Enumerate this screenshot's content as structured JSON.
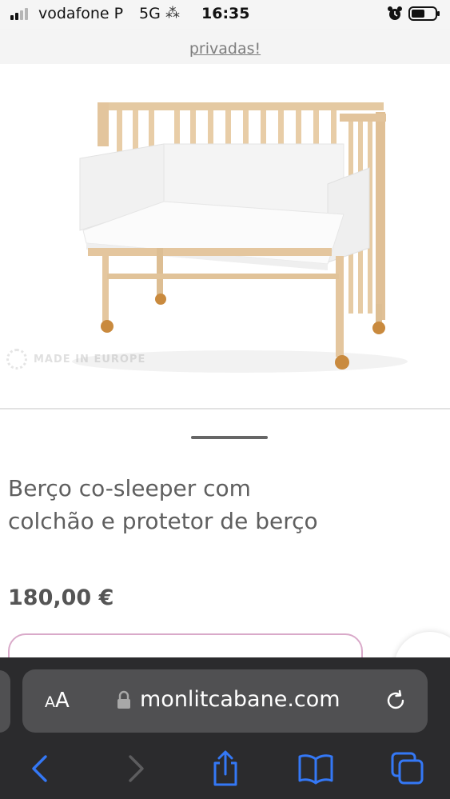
{
  "status_bar": {
    "carrier": "vodafone P",
    "network": "5G",
    "time": "16:35"
  },
  "top_strip": {
    "link_text": "privadas!"
  },
  "product": {
    "image_badge": "MADE IN EUROPE",
    "title": "Berço co-sleeper com colchão e protetor de berço",
    "price": "180,00 €"
  },
  "browser": {
    "text_size_label": "AA",
    "domain": "monlitcabane.com"
  },
  "icons": {
    "back": "chevron-left-icon",
    "forward": "chevron-right-icon",
    "share": "share-icon",
    "bookmarks": "book-icon",
    "tabs": "tabs-icon",
    "reload": "reload-icon",
    "lock": "lock-icon"
  },
  "colors": {
    "accent_blue": "#3478f6",
    "toolbar_bg": "#2b2b2d",
    "url_bar_bg": "#505052",
    "button_border": "#d9a9c9"
  }
}
